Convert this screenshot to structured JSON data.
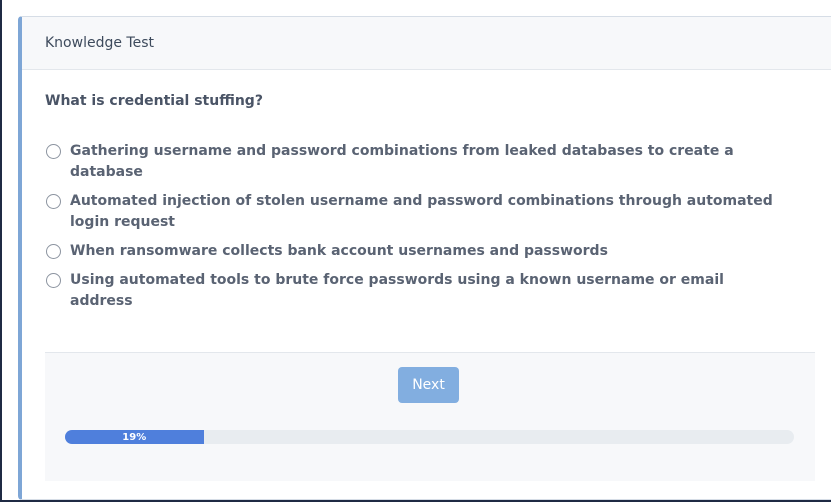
{
  "header": {
    "title": "Knowledge Test"
  },
  "question": {
    "text": "What is credential stuffing?"
  },
  "options": [
    {
      "label": "Gathering username and password combinations from leaked databases to create a database"
    },
    {
      "label": "Automated injection of stolen username and password combinations through automated login request"
    },
    {
      "label": "When ransomware collects bank account usernames and passwords"
    },
    {
      "label": "Using automated tools to brute force passwords using a known username or email address"
    }
  ],
  "footer": {
    "next_label": "Next",
    "progress_text": "19%",
    "progress_value": 0.19
  },
  "colors": {
    "accent": "#7ea6d6",
    "button": "#82aee0",
    "progress_fill": "#4f7fdc",
    "progress_track": "#e8ecf0"
  }
}
